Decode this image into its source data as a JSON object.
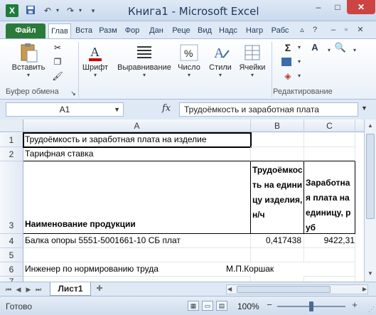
{
  "title": {
    "text": "Книга1  -  Microsoft Excel",
    "app_icon": "X"
  },
  "quick_access": {
    "save_icon": "save-icon",
    "undo_icon": "undo-icon",
    "redo_icon": "redo-icon",
    "customize_icon": "customize-icon"
  },
  "window_controls": {
    "minimize": "–",
    "maximize": "□",
    "close": "✕"
  },
  "tabs": {
    "file": "Файл",
    "items": [
      "Глав",
      "Вста",
      "Разм",
      "Фор",
      "Дан",
      "Реце",
      "Вид",
      "Надс",
      "Нагр",
      "Рабс"
    ]
  },
  "ribbon": {
    "paste_label": "Вставить",
    "clipboard_group": "Буфер обмена",
    "font_label": "Шрифт",
    "alignment_label": "Выравнивание",
    "number_label": "Число",
    "styles_label": "Стили",
    "cells_label": "Ячейки",
    "editing_group": "Редактирование",
    "font_icon_letter": "A",
    "number_icon": "%",
    "sum_icon": "Σ",
    "sort_icon": "A",
    "find_icon": "🔍"
  },
  "formula_bar": {
    "name_box": "A1",
    "fx": "fx",
    "formula": "Трудоёмкость и заработная плата"
  },
  "columns": [
    "A",
    "B",
    "C"
  ],
  "rows": [
    "1",
    "2",
    "3",
    "4",
    "5",
    "6",
    "7"
  ],
  "cells": {
    "a1": "Трудоёмкость и заработная плата на изделие",
    "a2": "Тарифная ставка",
    "a3": "Наименование продукции",
    "b3": "Трудоёмкость на единицу изделия, н/ч",
    "c3": "Заработная плата на единицу, руб",
    "a4": "Балка опоры 5551-5001661-10 СБ плат",
    "b4": "0,417438",
    "c4": "9422,31",
    "a6": " Инженер по нормированию труда",
    "b6": "М.П.Коршак"
  },
  "sheet_tabs": {
    "active": "Лист1"
  },
  "status": {
    "ready": "Готово",
    "zoom": "100%"
  }
}
